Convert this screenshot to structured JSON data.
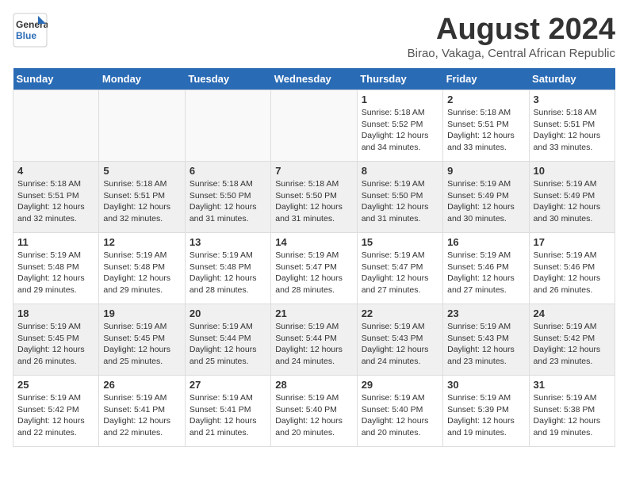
{
  "logo": {
    "line1": "General",
    "line2": "Blue"
  },
  "title": "August 2024",
  "subtitle": "Birao, Vakaga, Central African Republic",
  "days_of_week": [
    "Sunday",
    "Monday",
    "Tuesday",
    "Wednesday",
    "Thursday",
    "Friday",
    "Saturday"
  ],
  "weeks": [
    [
      {
        "num": "",
        "info": ""
      },
      {
        "num": "",
        "info": ""
      },
      {
        "num": "",
        "info": ""
      },
      {
        "num": "",
        "info": ""
      },
      {
        "num": "1",
        "info": "Sunrise: 5:18 AM\nSunset: 5:52 PM\nDaylight: 12 hours\nand 34 minutes."
      },
      {
        "num": "2",
        "info": "Sunrise: 5:18 AM\nSunset: 5:51 PM\nDaylight: 12 hours\nand 33 minutes."
      },
      {
        "num": "3",
        "info": "Sunrise: 5:18 AM\nSunset: 5:51 PM\nDaylight: 12 hours\nand 33 minutes."
      }
    ],
    [
      {
        "num": "4",
        "info": "Sunrise: 5:18 AM\nSunset: 5:51 PM\nDaylight: 12 hours\nand 32 minutes."
      },
      {
        "num": "5",
        "info": "Sunrise: 5:18 AM\nSunset: 5:51 PM\nDaylight: 12 hours\nand 32 minutes."
      },
      {
        "num": "6",
        "info": "Sunrise: 5:18 AM\nSunset: 5:50 PM\nDaylight: 12 hours\nand 31 minutes."
      },
      {
        "num": "7",
        "info": "Sunrise: 5:18 AM\nSunset: 5:50 PM\nDaylight: 12 hours\nand 31 minutes."
      },
      {
        "num": "8",
        "info": "Sunrise: 5:19 AM\nSunset: 5:50 PM\nDaylight: 12 hours\nand 31 minutes."
      },
      {
        "num": "9",
        "info": "Sunrise: 5:19 AM\nSunset: 5:49 PM\nDaylight: 12 hours\nand 30 minutes."
      },
      {
        "num": "10",
        "info": "Sunrise: 5:19 AM\nSunset: 5:49 PM\nDaylight: 12 hours\nand 30 minutes."
      }
    ],
    [
      {
        "num": "11",
        "info": "Sunrise: 5:19 AM\nSunset: 5:48 PM\nDaylight: 12 hours\nand 29 minutes."
      },
      {
        "num": "12",
        "info": "Sunrise: 5:19 AM\nSunset: 5:48 PM\nDaylight: 12 hours\nand 29 minutes."
      },
      {
        "num": "13",
        "info": "Sunrise: 5:19 AM\nSunset: 5:48 PM\nDaylight: 12 hours\nand 28 minutes."
      },
      {
        "num": "14",
        "info": "Sunrise: 5:19 AM\nSunset: 5:47 PM\nDaylight: 12 hours\nand 28 minutes."
      },
      {
        "num": "15",
        "info": "Sunrise: 5:19 AM\nSunset: 5:47 PM\nDaylight: 12 hours\nand 27 minutes."
      },
      {
        "num": "16",
        "info": "Sunrise: 5:19 AM\nSunset: 5:46 PM\nDaylight: 12 hours\nand 27 minutes."
      },
      {
        "num": "17",
        "info": "Sunrise: 5:19 AM\nSunset: 5:46 PM\nDaylight: 12 hours\nand 26 minutes."
      }
    ],
    [
      {
        "num": "18",
        "info": "Sunrise: 5:19 AM\nSunset: 5:45 PM\nDaylight: 12 hours\nand 26 minutes."
      },
      {
        "num": "19",
        "info": "Sunrise: 5:19 AM\nSunset: 5:45 PM\nDaylight: 12 hours\nand 25 minutes."
      },
      {
        "num": "20",
        "info": "Sunrise: 5:19 AM\nSunset: 5:44 PM\nDaylight: 12 hours\nand 25 minutes."
      },
      {
        "num": "21",
        "info": "Sunrise: 5:19 AM\nSunset: 5:44 PM\nDaylight: 12 hours\nand 24 minutes."
      },
      {
        "num": "22",
        "info": "Sunrise: 5:19 AM\nSunset: 5:43 PM\nDaylight: 12 hours\nand 24 minutes."
      },
      {
        "num": "23",
        "info": "Sunrise: 5:19 AM\nSunset: 5:43 PM\nDaylight: 12 hours\nand 23 minutes."
      },
      {
        "num": "24",
        "info": "Sunrise: 5:19 AM\nSunset: 5:42 PM\nDaylight: 12 hours\nand 23 minutes."
      }
    ],
    [
      {
        "num": "25",
        "info": "Sunrise: 5:19 AM\nSunset: 5:42 PM\nDaylight: 12 hours\nand 22 minutes."
      },
      {
        "num": "26",
        "info": "Sunrise: 5:19 AM\nSunset: 5:41 PM\nDaylight: 12 hours\nand 22 minutes."
      },
      {
        "num": "27",
        "info": "Sunrise: 5:19 AM\nSunset: 5:41 PM\nDaylight: 12 hours\nand 21 minutes."
      },
      {
        "num": "28",
        "info": "Sunrise: 5:19 AM\nSunset: 5:40 PM\nDaylight: 12 hours\nand 20 minutes."
      },
      {
        "num": "29",
        "info": "Sunrise: 5:19 AM\nSunset: 5:40 PM\nDaylight: 12 hours\nand 20 minutes."
      },
      {
        "num": "30",
        "info": "Sunrise: 5:19 AM\nSunset: 5:39 PM\nDaylight: 12 hours\nand 19 minutes."
      },
      {
        "num": "31",
        "info": "Sunrise: 5:19 AM\nSunset: 5:38 PM\nDaylight: 12 hours\nand 19 minutes."
      }
    ]
  ]
}
